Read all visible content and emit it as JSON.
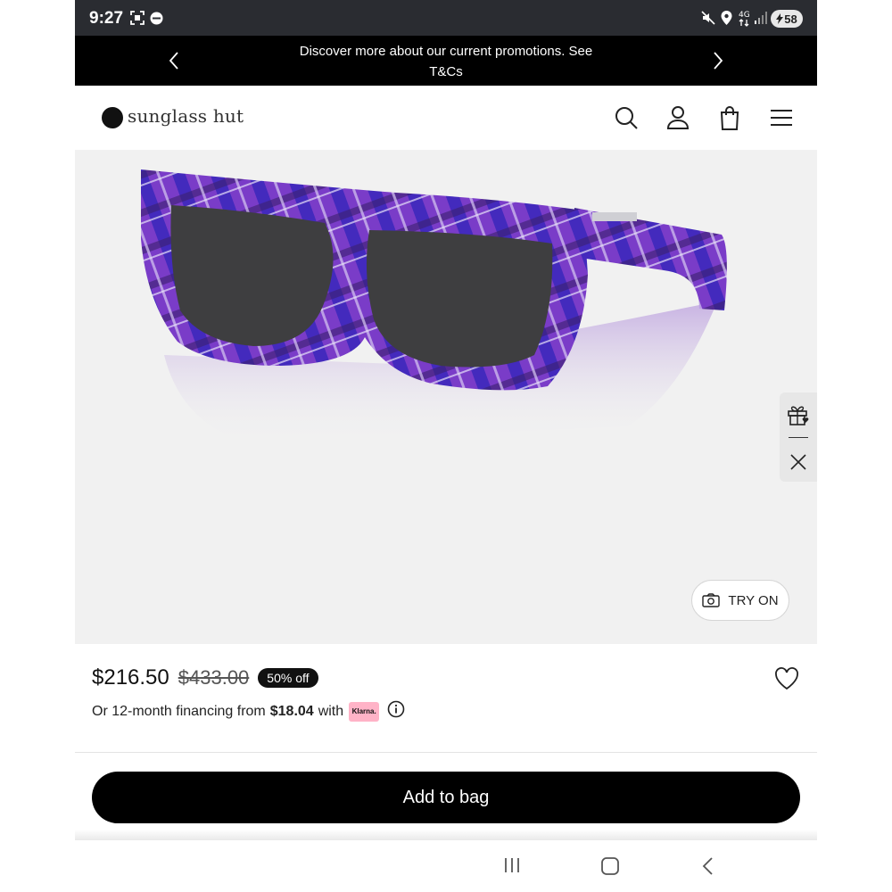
{
  "status_bar": {
    "time": "9:27",
    "network": "4G",
    "battery": "58",
    "icons": [
      "screenshot-icon",
      "wear-icon",
      "mute-icon",
      "location-icon",
      "network-icon",
      "signal-icon",
      "battery-charging-icon"
    ]
  },
  "promo_banner": {
    "text": "Discover more about our current promotions. See T&Cs",
    "icons": [
      "chevron-left-icon",
      "chevron-right-icon"
    ]
  },
  "header": {
    "logo_text": "sunglass hut",
    "icons": [
      "search-icon",
      "account-icon",
      "bag-icon",
      "menu-icon"
    ]
  },
  "product": {
    "image_alt": "purple tartan sunglasses",
    "try_on_label": "TRY ON",
    "side_widget_icons": [
      "gift-icon",
      "close-icon"
    ]
  },
  "price": {
    "current": "$216.50",
    "original": "$433.00",
    "discount": "50% off"
  },
  "financing": {
    "prefix": "Or 12-month financing from",
    "amount": "$18.04",
    "suffix": "with",
    "provider": "Klarna."
  },
  "cta": {
    "add_to_bag": "Add to bag"
  },
  "nav_bar": {
    "icons": [
      "recents-icon",
      "home-icon",
      "back-icon"
    ]
  },
  "colors": {
    "status_bar": "#2a2c31",
    "promo_bg": "#000000",
    "image_bg": "#f1f1f1",
    "klarna": "#ffb3c7",
    "frame_purple": "#7a3cc8"
  }
}
